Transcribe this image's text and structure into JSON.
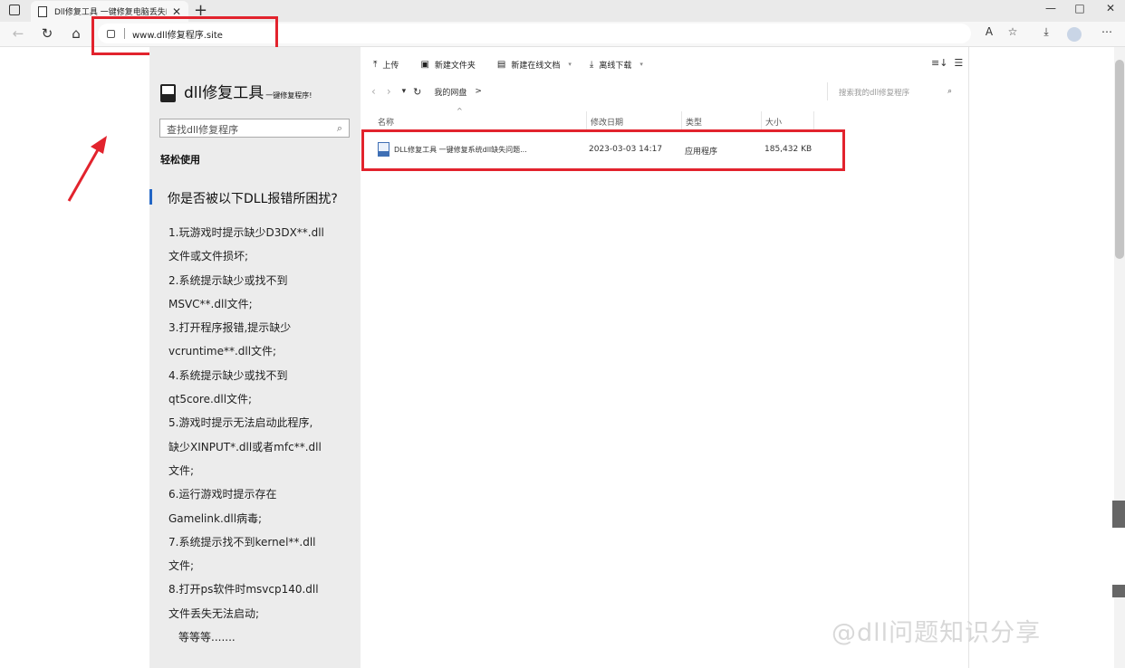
{
  "browser": {
    "tab_title": "Dll修复工具 一键修复电脑丢失D",
    "url": "www.dll修复程序.site"
  },
  "site": {
    "title": "dll修复工具",
    "subtitle": "一键修复程序!",
    "search_placeholder": "查找dll修复程序",
    "easy_use": "轻松使用",
    "question": "你是否被以下DLL报错所困扰?",
    "issues": [
      "1.玩游戏时提示缺少D3DX**.dll",
      "文件或文件损坏;",
      "2.系统提示缺少或找不到",
      "MSVC**.dll文件;",
      "3.打开程序报错,提示缺少",
      "vcruntime**.dll文件;",
      "4.系统提示缺少或找不到",
      "qt5core.dll文件;",
      "5.游戏时提示无法启动此程序,",
      "缺少XINPUT*.dll或者mfc**.dll",
      "文件;",
      "6.运行游戏时提示存在",
      "Gamelink.dll病毒;",
      "7.系统提示找不到kernel**.dll",
      "文件;",
      "8.打开ps软件时msvcp140.dll",
      "文件丢失无法启动;",
      "等等等......."
    ]
  },
  "drive": {
    "toolbar": {
      "upload": "上传",
      "new_folder": "新建文件夹",
      "new_online_doc": "新建在线文档",
      "offline_download": "离线下载"
    },
    "breadcrumb": "我的网盘",
    "breadcrumb_sep": ">",
    "search_placeholder": "搜索我的dll修复程序",
    "columns": {
      "name": "名称",
      "modified": "修改日期",
      "type": "类型",
      "size": "大小"
    },
    "file": {
      "name": "DLL修复工具 一键修复系统dll缺失问题...",
      "modified": "2023-03-03 14:17",
      "type": "应用程序",
      "size": "185,432 KB"
    }
  },
  "watermark": "@dll问题知识分享",
  "colors": {
    "highlight": "#e2232d",
    "accent": "#2366c5"
  }
}
